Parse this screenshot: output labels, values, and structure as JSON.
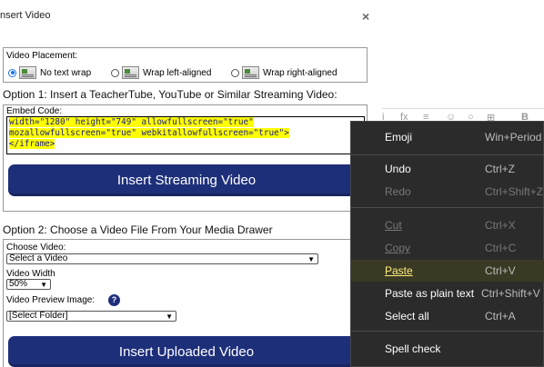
{
  "dialog": {
    "title": "nsert Video",
    "close_label": "×",
    "placement": {
      "legend": "Video Placement:",
      "options": [
        {
          "label": "No text wrap",
          "selected": true
        },
        {
          "label": "Wrap left-aligned",
          "selected": false
        },
        {
          "label": "Wrap right-aligned",
          "selected": false
        }
      ]
    },
    "option1": {
      "heading": "Option 1: Insert a TeacherTube, YouTube or Similar Streaming Video:",
      "embed_label": "Embed Code:",
      "code_lines": [
        "width=\"1280\" height=\"749\" allowfullscreen=\"true\"",
        "mozallowfullscreen=\"true\" webkitallowfullscreen=\"true\">",
        "</iframe>"
      ],
      "button": "Insert Streaming Video"
    },
    "option2": {
      "heading": "Option 2: Choose a Video File From Your Media Drawer",
      "choose_label": "Choose Video:",
      "choose_value": "Select a Video",
      "width_label": "Video Width",
      "width_value": "50%",
      "preview_label": "Video Preview Image:",
      "help_icon": "?",
      "preview_value": "[Select Folder]",
      "button": "Insert Uploaded Video"
    }
  },
  "editor_toolbar": [
    "i",
    "fx",
    "≡",
    "☺",
    "○",
    "⊞",
    "B"
  ],
  "context_menu": {
    "items": [
      {
        "label": "Emoji",
        "shortcut": "Win+Period",
        "disabled": false
      },
      {
        "label": "Undo",
        "shortcut": "Ctrl+Z",
        "disabled": false
      },
      {
        "label": "Redo",
        "shortcut": "Ctrl+Shift+Z",
        "disabled": true
      },
      {
        "label": "Cut",
        "shortcut": "Ctrl+X",
        "disabled": true
      },
      {
        "label": "Copy",
        "shortcut": "Ctrl+C",
        "disabled": true
      },
      {
        "label": "Paste",
        "shortcut": "Ctrl+V",
        "disabled": false
      },
      {
        "label": "Paste as plain text",
        "shortcut": "Ctrl+Shift+V",
        "disabled": false
      },
      {
        "label": "Select all",
        "shortcut": "Ctrl+A",
        "disabled": false
      },
      {
        "label": "Spell check",
        "shortcut": "",
        "disabled": false
      }
    ]
  }
}
